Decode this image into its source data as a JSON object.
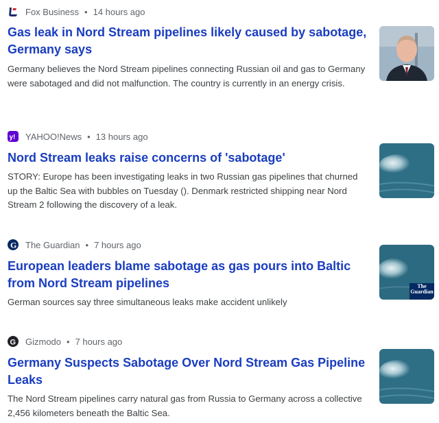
{
  "articles": [
    {
      "source": "Fox Business",
      "time": "14 hours ago",
      "title": "Gas leak in Nord Stream pipelines likely caused by sabotage, Germany says",
      "snippet": "Germany believes the Nord Stream pipelines connecting Russian oil and gas to Germany were sabotaged and did not malfunction. The country is currently in an energy crisis.",
      "source_icon": "fox-business-logo",
      "thumbnail": "portrait-photo"
    },
    {
      "source": "YAHOO!News",
      "time": "13 hours ago",
      "title": "Nord Stream leaks raise concerns of 'sabotage'",
      "snippet": "STORY: Europe has been investigating leaks in two Russian gas pipelines that churned up the Baltic Sea with bubbles on Tuesday (). Denmark restricted shipping near Nord Stream 2 following the discovery of a leak.",
      "source_icon": "yahoo-logo",
      "thumbnail": "sea-bubbles-photo"
    },
    {
      "source": "The Guardian",
      "time": "7 hours ago",
      "title": "European leaders blame sabotage as gas pours into Baltic from Nord Stream pipelines",
      "snippet": "German sources say three simultaneous leaks make accident unlikely",
      "source_icon": "guardian-logo",
      "thumbnail": "sea-bubbles-photo",
      "thumbnail_caption": "The Guardian"
    },
    {
      "source": "Gizmodo",
      "time": "7 hours ago",
      "title": "Germany Suspects Sabotage Over Nord Stream Gas Pipeline Leaks",
      "snippet": "The Nord Stream pipelines carry natural gas from Russia to Germany across a collective 2,456 kilometers beneath the Baltic Sea.",
      "source_icon": "gizmodo-logo",
      "thumbnail": "sea-bubbles-photo"
    }
  ],
  "separator": "•",
  "colors": {
    "title_link": "#1a3dbf",
    "meta_text": "#5f6368",
    "snippet_text": "#3c4043",
    "yahoo_purple": "#6001d2",
    "sea": "#2f6f86"
  }
}
